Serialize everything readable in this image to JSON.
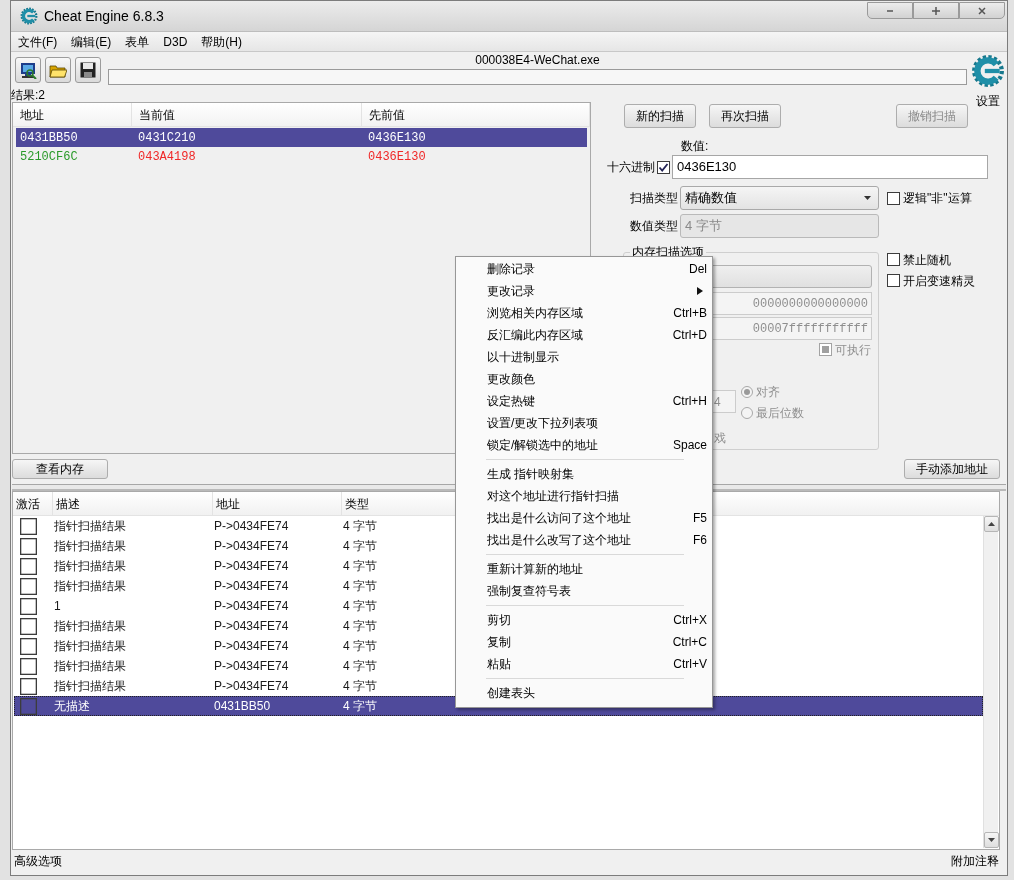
{
  "window": {
    "title": "Cheat Engine 6.8.3"
  },
  "menu_bar": [
    "文件(F)",
    "编辑(E)",
    "表单",
    "D3D",
    "帮助(H)"
  ],
  "toolbar": {
    "process": "000038E4-WeChat.exe",
    "progress": {
      "level": 0
    },
    "settings_label": "设置"
  },
  "results": {
    "count": "结果:2",
    "columns": [
      "地址",
      "当前值",
      "先前值"
    ],
    "rows": [
      {
        "address": "0431BB50",
        "current": "0431C210",
        "previous": "0436E130",
        "selected": true
      },
      {
        "address": "5210CF6C",
        "current": "043A4198",
        "previous": "0436E130",
        "selected": false,
        "static_address": true,
        "value_changed": true
      }
    ]
  },
  "scan_panel": {
    "buttons": [
      {
        "label": "新的扫描",
        "disabled": false
      },
      {
        "label": "再次扫描",
        "disabled": false
      },
      {
        "label": "撤销扫描",
        "disabled": true
      }
    ],
    "value_label": "数值:",
    "hex": {
      "label": "十六进制",
      "checked": true
    },
    "value": "0436E130",
    "scan_type": {
      "label": "扫描类型",
      "value": "精确数值"
    },
    "not_operator": {
      "label": "逻辑\"非\"运算",
      "checked": false
    },
    "value_type": {
      "label": "数值类型",
      "value": "4 字节",
      "disabled": true
    },
    "memory_options": {
      "title": "内存扫描选项",
      "disabled": true,
      "start": "0000000000000000",
      "stop": "00007fffffffffff",
      "executable": {
        "label": "可执行",
        "checked": false,
        "indeterminate": true
      },
      "alignment_value": "4",
      "alignment_modes": [
        {
          "label": "对齐",
          "selected": true
        },
        {
          "label": "最后位数",
          "selected": false
        }
      ],
      "label_fragment": "戏"
    },
    "extra_options": [
      {
        "label": "禁止随机",
        "checked": false
      },
      {
        "label": "开启变速精灵",
        "checked": false
      }
    ]
  },
  "bottom_buttons": {
    "view_memory": "查看内存",
    "add_address": "手动添加地址"
  },
  "address_list": {
    "columns": [
      "激活",
      "描述",
      "地址",
      "类型"
    ],
    "rows": [
      {
        "active": false,
        "description": "指针扫描结果",
        "address": "P->0434FE74",
        "type": "4 字节",
        "selected": false
      },
      {
        "active": false,
        "description": "指针扫描结果",
        "address": "P->0434FE74",
        "type": "4 字节",
        "selected": false
      },
      {
        "active": false,
        "description": "指针扫描结果",
        "address": "P->0434FE74",
        "type": "4 字节",
        "selected": false
      },
      {
        "active": false,
        "description": "指针扫描结果",
        "address": "P->0434FE74",
        "type": "4 字节",
        "selected": false
      },
      {
        "active": false,
        "description": "1",
        "address": "P->0434FE74",
        "type": "4 字节",
        "selected": false
      },
      {
        "active": false,
        "description": "指针扫描结果",
        "address": "P->0434FE74",
        "type": "4 字节",
        "selected": false
      },
      {
        "active": false,
        "description": "指针扫描结果",
        "address": "P->0434FE74",
        "type": "4 字节",
        "selected": false
      },
      {
        "active": false,
        "description": "指针扫描结果",
        "address": "P->0434FE74",
        "type": "4 字节",
        "selected": false
      },
      {
        "active": false,
        "description": "指针扫描结果",
        "address": "P->0434FE74",
        "type": "4 字节",
        "selected": false
      },
      {
        "active": false,
        "description": "无描述",
        "address": "0431BB50",
        "type": "4 字节",
        "selected": true
      }
    ]
  },
  "footer": {
    "advanced": "高级选项",
    "comments": "附加注释"
  },
  "context_menu": [
    {
      "kind": "item",
      "label": "删除记录",
      "shortcut": "Del"
    },
    {
      "kind": "item",
      "label": "更改记录",
      "submenu": true
    },
    {
      "kind": "item",
      "label": "浏览相关内存区域",
      "shortcut": "Ctrl+B"
    },
    {
      "kind": "item",
      "label": "反汇编此内存区域",
      "shortcut": "Ctrl+D"
    },
    {
      "kind": "item",
      "label": "以十进制显示"
    },
    {
      "kind": "item",
      "label": "更改颜色"
    },
    {
      "kind": "item",
      "label": "设定热键",
      "shortcut": "Ctrl+H"
    },
    {
      "kind": "item",
      "label": "设置/更改下拉列表项"
    },
    {
      "kind": "item",
      "label": "锁定/解锁选中的地址",
      "shortcut": "Space"
    },
    {
      "kind": "separator"
    },
    {
      "kind": "item",
      "label": "生成 指针映射集"
    },
    {
      "kind": "item",
      "label": "对这个地址进行指针扫描"
    },
    {
      "kind": "item",
      "label": "找出是什么访问了这个地址",
      "shortcut": "F5"
    },
    {
      "kind": "item",
      "label": "找出是什么改写了这个地址",
      "shortcut": "F6"
    },
    {
      "kind": "separator"
    },
    {
      "kind": "item",
      "label": "重新计算新的地址"
    },
    {
      "kind": "item",
      "label": "强制复查符号表"
    },
    {
      "kind": "separator"
    },
    {
      "kind": "item",
      "label": "剪切",
      "shortcut": "Ctrl+X"
    },
    {
      "kind": "item",
      "label": "复制",
      "shortcut": "Ctrl+C"
    },
    {
      "kind": "item",
      "label": "粘贴",
      "shortcut": "Ctrl+V"
    },
    {
      "kind": "separator"
    },
    {
      "kind": "item",
      "label": "创建表头"
    }
  ]
}
